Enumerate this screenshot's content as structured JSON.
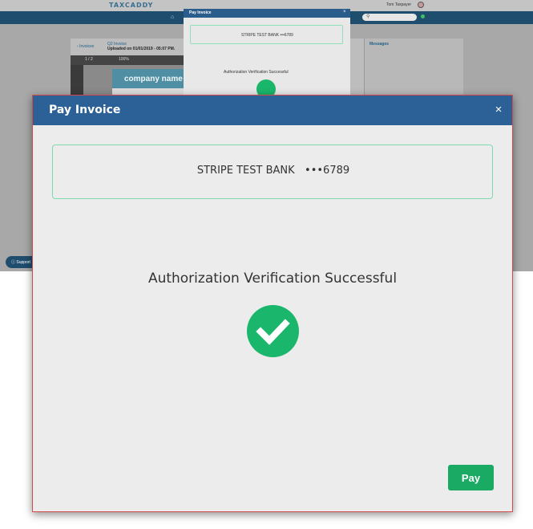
{
  "background": {
    "logo": "TAXCADDY",
    "user_name": "Tom Taxpayer",
    "breadcrumb_back": "‹ Invoices",
    "document_title": "Q2 Invoice",
    "document_subtitle": "Uploaded on 01/01/2019 - 05:07 PM.",
    "viewer_page": "1 / 2",
    "viewer_zoom": "100%",
    "doc_company_name": "company name",
    "messages_title": "Messages",
    "support_label": "Support"
  },
  "mini_modal": {
    "title": "Pay Invoice",
    "close_glyph": "×",
    "bank_text": "STRIPE TEST BANK   •••6789",
    "status": "Authorization Verification Successful"
  },
  "modal": {
    "title": "Pay Invoice",
    "close_glyph": "×",
    "bank_name": "STRIPE TEST BANK",
    "bank_masked": "•••6789",
    "status": "Authorization Verification Successful",
    "check_icon": "check-circle-icon",
    "pay_label": "Pay"
  },
  "colors": {
    "header": "#2b6196",
    "success": "#1ab66b",
    "button": "#1aaa63",
    "border": "#7fd9ac"
  }
}
